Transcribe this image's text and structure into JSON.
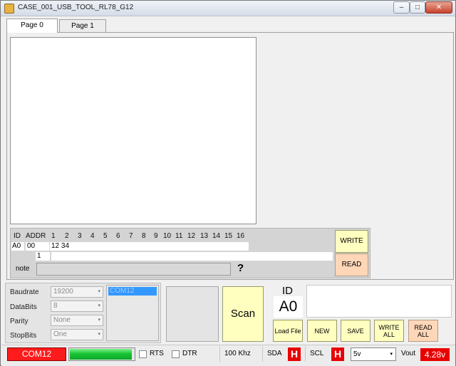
{
  "window": {
    "title": "CASE_001_USB_TOOL_RL78_G12",
    "min_glyph": "–",
    "max_glyph": "□",
    "close_glyph": "✕"
  },
  "tabs": [
    {
      "label": "Page 0",
      "active": true
    },
    {
      "label": "Page 1",
      "active": false
    }
  ],
  "grid": {
    "headers": [
      "ID",
      "ADDR",
      "1",
      "2",
      "3",
      "4",
      "5",
      "6",
      "7",
      "8",
      "9",
      "10",
      "11",
      "12",
      "13",
      "14",
      "15",
      "16"
    ],
    "row_id": "A0",
    "row_addr": "00",
    "row_data": "12 34",
    "row2_index": "1",
    "note_label": "note",
    "help": "?",
    "write_label": "WRITE",
    "read_label": "READ"
  },
  "serial": {
    "baudrate_label": "Baudrate",
    "baudrate": "19200",
    "databits_label": "DataBits",
    "databits": "8",
    "parity_label": "Parity",
    "parity": "None",
    "stopbits_label": "StopBits",
    "stopbits": "One",
    "ports": [
      "COM12"
    ],
    "dropdown_glyph": "▾"
  },
  "scan_label": "Scan",
  "device": {
    "id_label": "ID",
    "id_value": "A0",
    "load_file": "Load File",
    "new": "NEW",
    "save": "SAVE",
    "write_all": "WRITE ALL",
    "read_all": "READ ALL"
  },
  "status": {
    "com": "COM12",
    "progress_fraction": 0.97,
    "rts_label": "RTS",
    "dtr_label": "DTR",
    "speed": "100 Khz",
    "sda_label": "SDA",
    "sda_state": "H",
    "scl_label": "SCL",
    "scl_state": "H",
    "voltage_select": "5v",
    "vout_label": "Vout",
    "vout_value": "4.28v"
  },
  "colors": {
    "button_yellow": "#ffffc0",
    "button_peach": "#ffd7b8",
    "status_red": "#ff1b1b",
    "progress_green": "#18c534",
    "selection_blue": "#3399ff"
  }
}
